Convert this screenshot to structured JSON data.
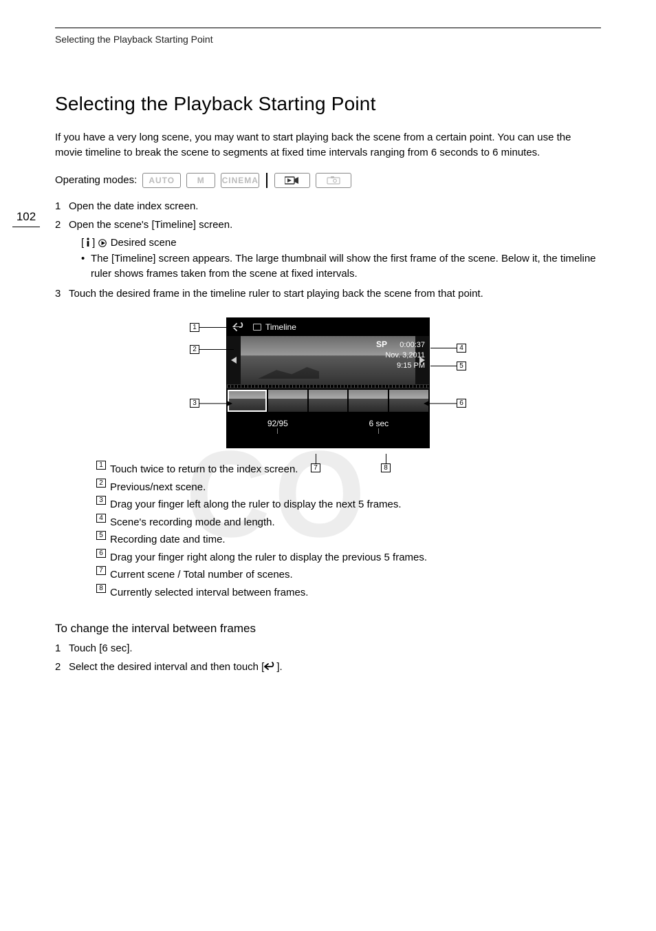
{
  "running_head": "Selecting the Playback Starting Point",
  "page_number": "102",
  "title": "Selecting the Playback Starting Point",
  "intro": "If you have a very long scene, you may want to start playing back the scene from a certain point. You can use the movie timeline to break the scene to segments at fixed time intervals ranging from 6 seconds to 6 minutes.",
  "operating_modes_label": "Operating modes:",
  "modes": {
    "auto": "AUTO",
    "m": "M",
    "cinema": "CINEMA"
  },
  "steps": {
    "s1": "Open the date index screen.",
    "s2": "Open the scene's [Timeline] screen.",
    "s2a_prefix": "[",
    "s2a_suffix": "]  ",
    "s2a_tail": " Desired scene",
    "s2b": "The [Timeline] screen appears. The large thumbnail will show the first frame of the scene. Below it, the timeline ruler shows frames taken from the scene at fixed intervals.",
    "s3": "Touch the desired frame in the timeline ruler to start playing back the scene from that point."
  },
  "screen": {
    "top_title": "Timeline",
    "sp": "SP",
    "duration": "0:00:37",
    "date": "Nov.  3,2011",
    "time": "9:15 PM",
    "counter": "92/95",
    "interval": "6 sec"
  },
  "legend": {
    "l1": "Touch twice to return to the index screen.",
    "l2": "Previous/next scene.",
    "l3": "Drag your finger left along the ruler to display the next 5 frames.",
    "l4": "Scene's recording mode and length.",
    "l5": "Recording date and time.",
    "l6": "Drag your finger right along the ruler to display the previous 5 frames.",
    "l7": "Current scene / Total number of scenes.",
    "l8": "Currently selected interval between frames."
  },
  "subheading": "To change the interval between frames",
  "steps2": {
    "s1": "Touch [6 sec].",
    "s2_pre": "Select the desired interval and then touch [",
    "s2_post": "]."
  },
  "watermark": "CO"
}
